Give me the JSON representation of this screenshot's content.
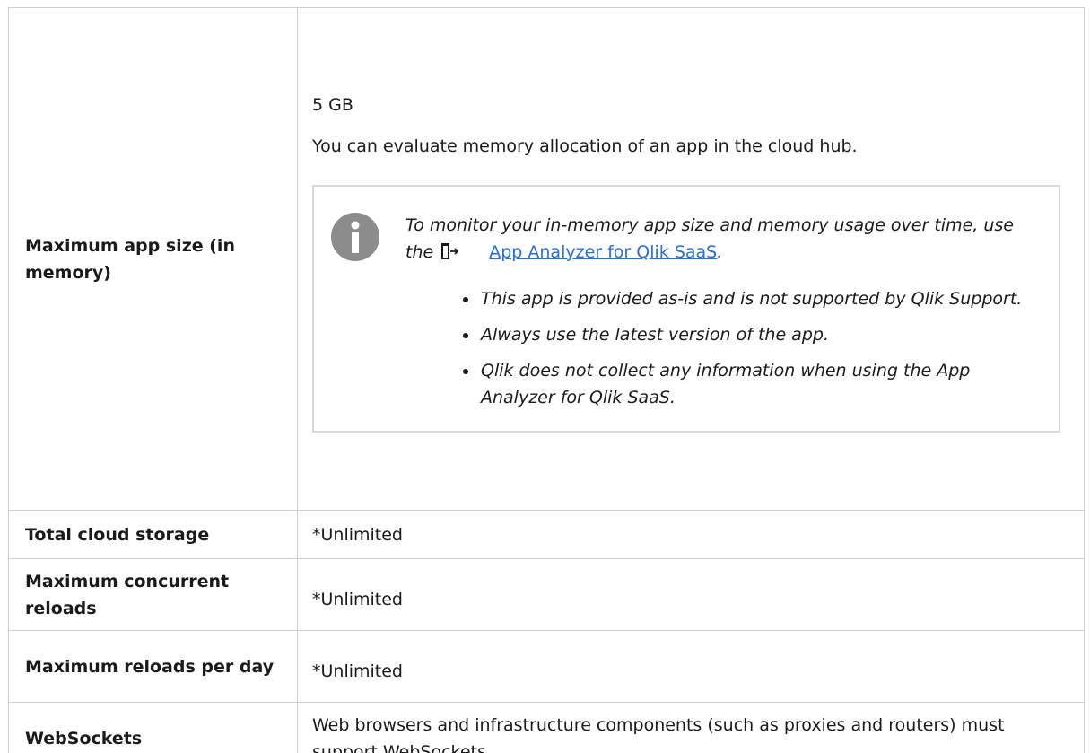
{
  "rows": [
    {
      "label": "Maximum app size (in memory)",
      "value": "5 GB",
      "description": "You can evaluate memory allocation of an app in the cloud hub.",
      "note": {
        "icon": "info-icon",
        "text_before_link": "To monitor your in-memory app size and memory usage over time, use the",
        "link_icon": "external-link-icon",
        "link_text": "App Analyzer for Qlik SaaS",
        "text_after_link": ".",
        "bullets": [
          "This app is provided as-is and is not supported by Qlik Support.",
          "Always use the latest version of the app.",
          "Qlik does not collect any information when using the App Analyzer for Qlik SaaS."
        ]
      }
    },
    {
      "label": "Total cloud storage",
      "value": "*Unlimited"
    },
    {
      "label": "Maximum concurrent reloads",
      "value": "*Unlimited"
    },
    {
      "label": "Maximum reloads per day",
      "value": "*Unlimited"
    },
    {
      "label": "WebSockets",
      "value": "Web browsers and infrastructure components (such as proxies and routers) must support WebSockets."
    }
  ],
  "colors": {
    "link": "#2a6fd6",
    "border": "#cfcfcf",
    "info_icon": "#8c8c8c"
  }
}
